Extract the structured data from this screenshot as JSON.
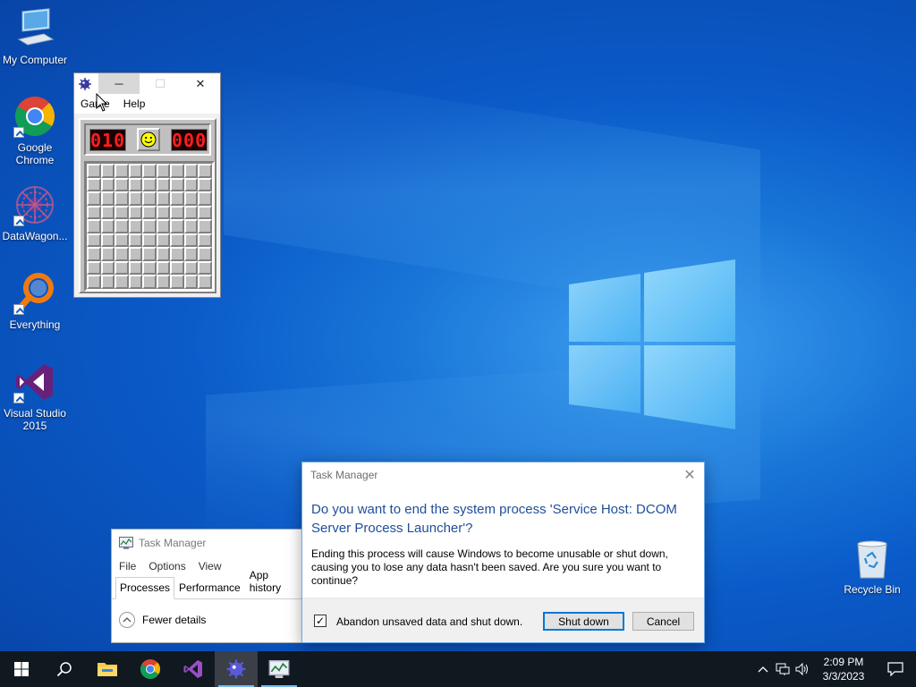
{
  "desktop": {
    "icons": [
      {
        "label": "My Computer"
      },
      {
        "label": "Google Chrome"
      },
      {
        "label": "DataWagon..."
      },
      {
        "label": "Everything"
      },
      {
        "label": "Visual Studio 2015"
      }
    ],
    "recycle_bin": {
      "label": "Recycle Bin"
    }
  },
  "minesweeper": {
    "menu": [
      "Game",
      "Help"
    ],
    "mine_counter": "010",
    "timer": "000",
    "grid_rows": 9,
    "grid_cols": 9
  },
  "task_manager": {
    "title": "Task Manager",
    "menu": [
      "File",
      "Options",
      "View"
    ],
    "tabs": [
      "Processes",
      "Performance",
      "App history"
    ],
    "active_tab": "Processes",
    "fewer_details": "Fewer details"
  },
  "dialog": {
    "title": "Task Manager",
    "question": "Do you want to end the system process 'Service Host: DCOM Server Process Launcher'?",
    "description": "Ending this process will cause Windows to become unusable or shut down, causing you to lose any data hasn't been saved. Are you sure you want to continue?",
    "checkbox_label": "Abandon unsaved data and shut down.",
    "checkbox_checked": true,
    "checkmark": "✓",
    "close_glyph": "✕",
    "shutdown_button": "Shut down",
    "cancel_button": "Cancel"
  },
  "taskbar": {
    "time": "2:09 PM",
    "date": "3/3/2023"
  },
  "colors": {
    "accent": "#0078d7",
    "dialog_heading": "#1f4e9a"
  }
}
